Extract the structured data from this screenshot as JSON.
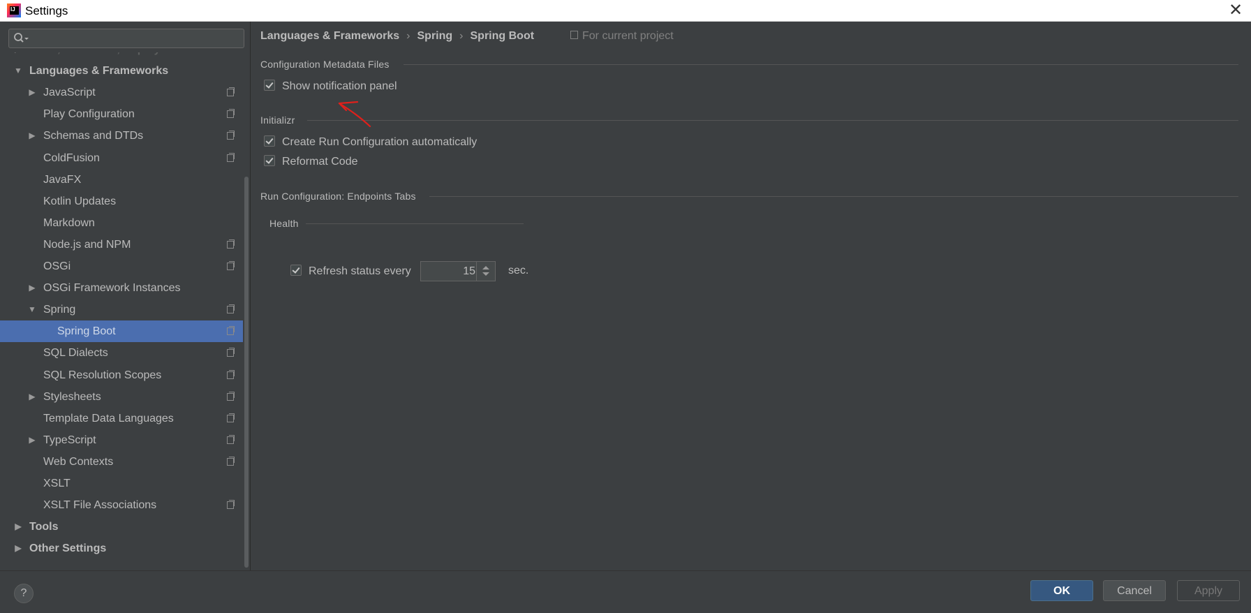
{
  "window": {
    "title": "Settings"
  },
  "sidebar": {
    "search": {
      "placeholder": "",
      "value": ""
    },
    "items": [
      {
        "label": "Build, Execution, Deployment",
        "level": 0,
        "arrow": "right",
        "bold": true,
        "faded": true,
        "project_icon": false
      },
      {
        "label": "Languages & Frameworks",
        "level": 0,
        "arrow": "down",
        "bold": true,
        "project_icon": false
      },
      {
        "label": "JavaScript",
        "level": 1,
        "arrow": "right",
        "project_icon": true
      },
      {
        "label": "Play Configuration",
        "level": 1,
        "arrow": "",
        "project_icon": true
      },
      {
        "label": "Schemas and DTDs",
        "level": 1,
        "arrow": "right",
        "project_icon": true
      },
      {
        "label": "ColdFusion",
        "level": 1,
        "arrow": "",
        "project_icon": true
      },
      {
        "label": "JavaFX",
        "level": 1,
        "arrow": "",
        "project_icon": false
      },
      {
        "label": "Kotlin Updates",
        "level": 1,
        "arrow": "",
        "project_icon": false
      },
      {
        "label": "Markdown",
        "level": 1,
        "arrow": "",
        "project_icon": false
      },
      {
        "label": "Node.js and NPM",
        "level": 1,
        "arrow": "",
        "project_icon": true
      },
      {
        "label": "OSGi",
        "level": 1,
        "arrow": "",
        "project_icon": true
      },
      {
        "label": "OSGi Framework Instances",
        "level": 1,
        "arrow": "right",
        "project_icon": false
      },
      {
        "label": "Spring",
        "level": 1,
        "arrow": "down",
        "project_icon": true
      },
      {
        "label": "Spring Boot",
        "level": 2,
        "arrow": "",
        "project_icon": true,
        "selected": true
      },
      {
        "label": "SQL Dialects",
        "level": 1,
        "arrow": "",
        "project_icon": true
      },
      {
        "label": "SQL Resolution Scopes",
        "level": 1,
        "arrow": "",
        "project_icon": true
      },
      {
        "label": "Stylesheets",
        "level": 1,
        "arrow": "right",
        "project_icon": true
      },
      {
        "label": "Template Data Languages",
        "level": 1,
        "arrow": "",
        "project_icon": true
      },
      {
        "label": "TypeScript",
        "level": 1,
        "arrow": "right",
        "project_icon": true
      },
      {
        "label": "Web Contexts",
        "level": 1,
        "arrow": "",
        "project_icon": true
      },
      {
        "label": "XSLT",
        "level": 1,
        "arrow": "",
        "project_icon": false
      },
      {
        "label": "XSLT File Associations",
        "level": 1,
        "arrow": "",
        "project_icon": true
      },
      {
        "label": "Tools",
        "level": 0,
        "arrow": "right",
        "bold": true,
        "project_icon": false
      },
      {
        "label": "Other Settings",
        "level": 0,
        "arrow": "right",
        "bold": true,
        "project_icon": false
      }
    ]
  },
  "main": {
    "breadcrumb": [
      "Languages & Frameworks",
      "Spring",
      "Spring Boot"
    ],
    "breadcrumb_separator": "›",
    "scope_label": "For current project",
    "sections": {
      "metadata": {
        "title": "Configuration Metadata Files",
        "show_notification_panel": {
          "label": "Show notification panel",
          "checked": true
        }
      },
      "initializr": {
        "title": "Initializr",
        "create_run_config": {
          "label": "Create Run Configuration automatically",
          "checked": true
        },
        "reformat_code": {
          "label": "Reformat Code",
          "checked": true
        }
      },
      "run_config": {
        "title": "Run Configuration: Endpoints Tabs",
        "health": {
          "title": "Health",
          "refresh": {
            "label": "Refresh status every",
            "checked": true,
            "value": "15",
            "unit": "sec."
          }
        }
      }
    }
  },
  "footer": {
    "help_label": "?",
    "ok_label": "OK",
    "cancel_label": "Cancel",
    "apply_label": "Apply"
  },
  "colors": {
    "background": "#3c3f41",
    "selection": "#4b6eaf",
    "text": "#bbbbbb",
    "ok_button": "#365880",
    "annotation_arrow": "#e0201b"
  }
}
